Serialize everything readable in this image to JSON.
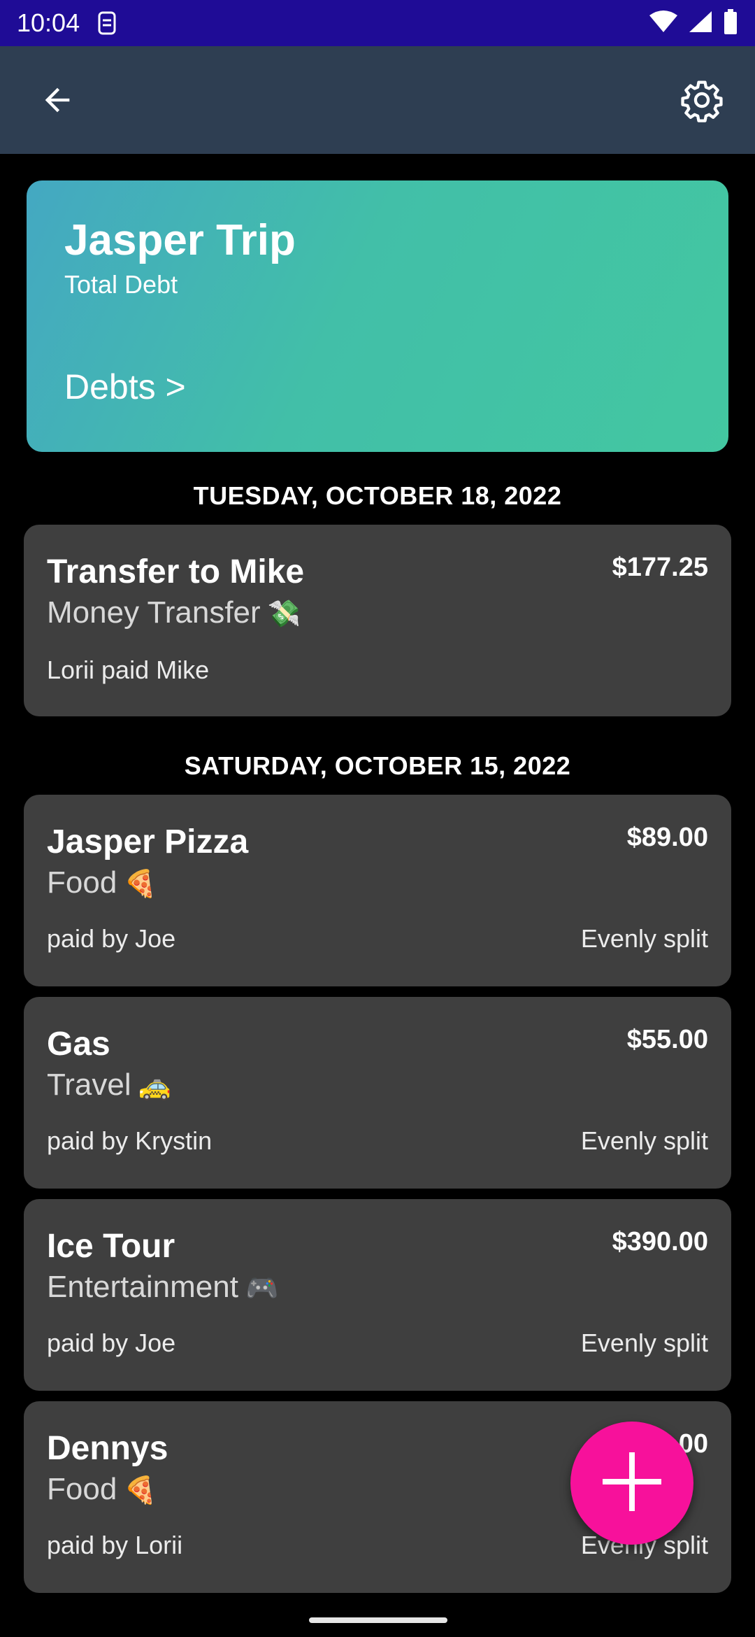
{
  "status_bar": {
    "time": "10:04"
  },
  "trip": {
    "title": "Jasper Trip",
    "subtitle": "Total Debt",
    "debts_link": "Debts >"
  },
  "sections": [
    {
      "date": "TUESDAY, OCTOBER 18, 2022",
      "expenses": [
        {
          "name": "Transfer to Mike",
          "amount": "$177.25",
          "category": "Money Transfer",
          "emoji": "💸",
          "payer": "Lorii paid Mike",
          "split": ""
        }
      ]
    },
    {
      "date": "SATURDAY, OCTOBER 15, 2022",
      "expenses": [
        {
          "name": "Jasper Pizza",
          "amount": "$89.00",
          "category": "Food",
          "emoji": "🍕",
          "payer": "paid by Joe",
          "split": "Evenly split"
        },
        {
          "name": "Gas",
          "amount": "$55.00",
          "category": "Travel",
          "emoji": "🚕",
          "payer": "paid by Krystin",
          "split": "Evenly split"
        },
        {
          "name": "Ice Tour",
          "amount": "$390.00",
          "category": "Entertainment",
          "emoji": "🎮",
          "payer": "paid by Joe",
          "split": "Evenly split"
        },
        {
          "name": "Dennys",
          "amount": "$__.00",
          "category": "Food",
          "emoji": "🍕",
          "payer": "paid by Lorii",
          "split": "Evenly split"
        }
      ]
    }
  ],
  "icons": {
    "back": "arrow-back-icon",
    "settings": "gear-icon",
    "add": "plus-icon"
  },
  "colors": {
    "status_bar": "#1f0c96",
    "app_bar": "#2e3e52",
    "card": "#3f3f3f",
    "fab": "#f7119b",
    "gradient_start": "#44a8c2",
    "gradient_end": "#43c7a1"
  }
}
